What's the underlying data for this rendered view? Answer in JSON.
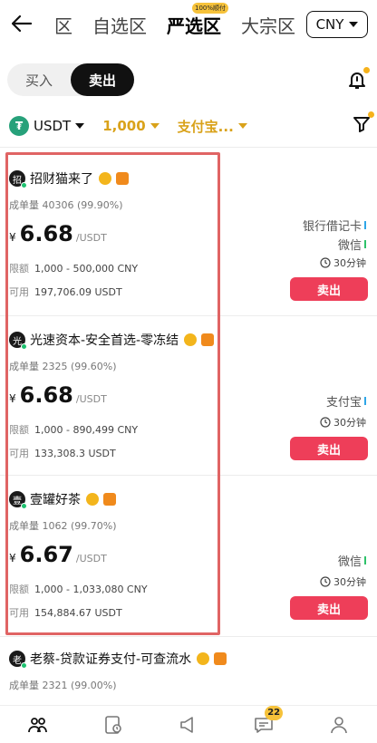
{
  "header": {
    "tabs": [
      {
        "label": "区"
      },
      {
        "label": "自选区"
      },
      {
        "label": "严选区",
        "badge": "100%顺付"
      },
      {
        "label": "大宗区"
      }
    ],
    "active_tab": 2,
    "currency": "CNY"
  },
  "toggle": {
    "buy_label": "买入",
    "sell_label": "卖出",
    "active": "sell"
  },
  "filters": {
    "coin": "USDT",
    "coin_logo": "₮",
    "amount": "1,000",
    "payment": "支付宝..."
  },
  "colors": {
    "accent_gold": "#d9a21a",
    "sell_red": "#ee3e59",
    "online_green": "#1ec270"
  },
  "listings": [
    {
      "avatar_char": "招",
      "name": "招财猫来了",
      "stats_label": "成单量",
      "stats_value": "40306 (99.90%)",
      "currency_symbol": "¥",
      "price": "6.68",
      "price_unit": "/USDT",
      "limit_label": "限额",
      "limit_value": "1,000 - 500,000 CNY",
      "avail_label": "可用",
      "avail_value": "197,706.09 USDT",
      "payment_methods": [
        "银行借记卡",
        "微信"
      ],
      "time": "30分钟",
      "button": "卖出"
    },
    {
      "avatar_char": "光",
      "name": "光速资本-安全首选-零冻结",
      "stats_label": "成单量",
      "stats_value": "2325 (99.60%)",
      "currency_symbol": "¥",
      "price": "6.68",
      "price_unit": "/USDT",
      "limit_label": "限额",
      "limit_value": "1,000 - 890,499 CNY",
      "avail_label": "可用",
      "avail_value": "133,308.3 USDT",
      "payment_methods": [
        "支付宝"
      ],
      "time": "30分钟",
      "button": "卖出"
    },
    {
      "avatar_char": "壹",
      "name": "壹罐好茶",
      "stats_label": "成单量",
      "stats_value": "1062 (99.70%)",
      "currency_symbol": "¥",
      "price": "6.67",
      "price_unit": "/USDT",
      "limit_label": "限额",
      "limit_value": "1,000 - 1,033,080 CNY",
      "avail_label": "可用",
      "avail_value": "154,884.67 USDT",
      "payment_methods": [
        "微信"
      ],
      "time": "30分钟",
      "button": "卖出"
    },
    {
      "avatar_char": "老",
      "name": "老蔡-贷款证券支付-可查流水",
      "stats_label": "成单量",
      "stats_value": "2321 (99.00%)"
    }
  ],
  "bottom_nav": {
    "message_badge": "22"
  }
}
